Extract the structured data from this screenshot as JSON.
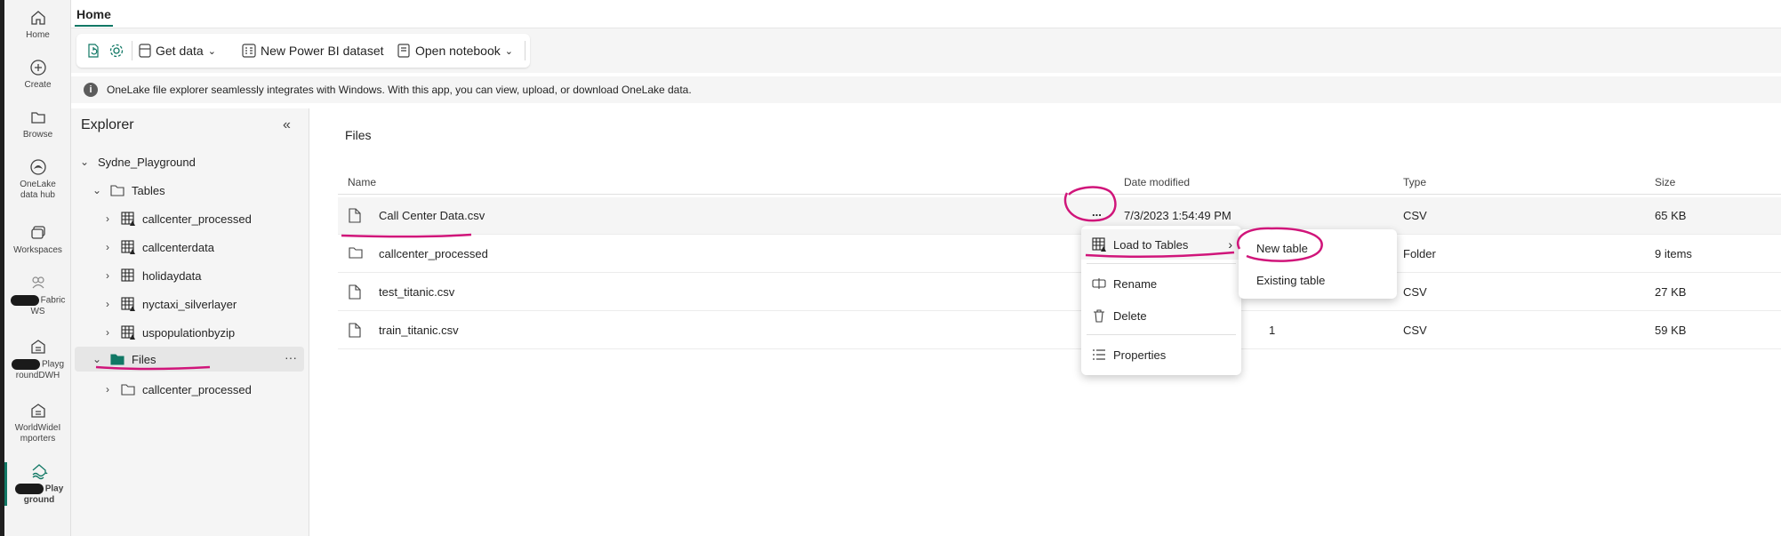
{
  "nav": {
    "items": [
      {
        "label": "Home",
        "icon": "home-icon"
      },
      {
        "label": "Create",
        "icon": "create-icon"
      },
      {
        "label": "Browse",
        "icon": "browse-icon"
      },
      {
        "label_line1": "OneLake",
        "label_line2": "data hub",
        "icon": "onelake-icon"
      },
      {
        "label": "Workspaces",
        "icon": "workspaces-icon"
      },
      {
        "label_line1": "Fabric",
        "label_line2": "WS",
        "icon": "fabric-ws-icon"
      },
      {
        "label_line1": "Playg",
        "label_line2": "roundDWH",
        "icon": "warehouse-icon"
      },
      {
        "label_line1": "WorldWideI",
        "label_line2": "mporters",
        "icon": "warehouse-icon"
      },
      {
        "label_line1": "Play",
        "label_line2": "ground",
        "icon": "lakehouse-icon"
      }
    ]
  },
  "header": {
    "tab": "Home"
  },
  "toolbar": {
    "get_data": "Get data",
    "new_dataset": "New Power BI dataset",
    "open_notebook": "Open notebook"
  },
  "info": {
    "text": "OneLake file explorer seamlessly integrates with Windows. With this app, you can view, upload, or download OneLake data."
  },
  "explorer": {
    "title": "Explorer",
    "root": "Sydne_Playground",
    "tables_label": "Tables",
    "tables": [
      "callcenter_processed",
      "callcenterdata",
      "holidaydata",
      "nyctaxi_silverlayer",
      "uspopulationbyzip"
    ],
    "files_label": "Files",
    "files": [
      "callcenter_processed"
    ],
    "more": "···"
  },
  "main": {
    "title": "Files",
    "columns": {
      "name": "Name",
      "date": "Date modified",
      "type": "Type",
      "size": "Size"
    },
    "rows": [
      {
        "name": "Call Center Data.csv",
        "date": "7/3/2023 1:54:49 PM",
        "type": "CSV",
        "size": "65 KB",
        "kind": "file"
      },
      {
        "name": "callcenter_processed",
        "date": "",
        "type": "Folder",
        "size": "9 items",
        "kind": "folder"
      },
      {
        "name": "test_titanic.csv",
        "date": "",
        "type": "CSV",
        "size": "27 KB",
        "kind": "file"
      },
      {
        "name": "train_titanic.csv",
        "date": "1",
        "type": "CSV",
        "size": "59 KB",
        "kind": "file"
      }
    ],
    "row_more": "..."
  },
  "context_menu": {
    "load_to_tables": "Load to Tables",
    "rename": "Rename",
    "delete": "Delete",
    "properties": "Properties"
  },
  "submenu": {
    "new_table": "New table",
    "existing_table": "Existing table"
  },
  "colors": {
    "accent": "#117865",
    "annotation": "#d0157a"
  }
}
